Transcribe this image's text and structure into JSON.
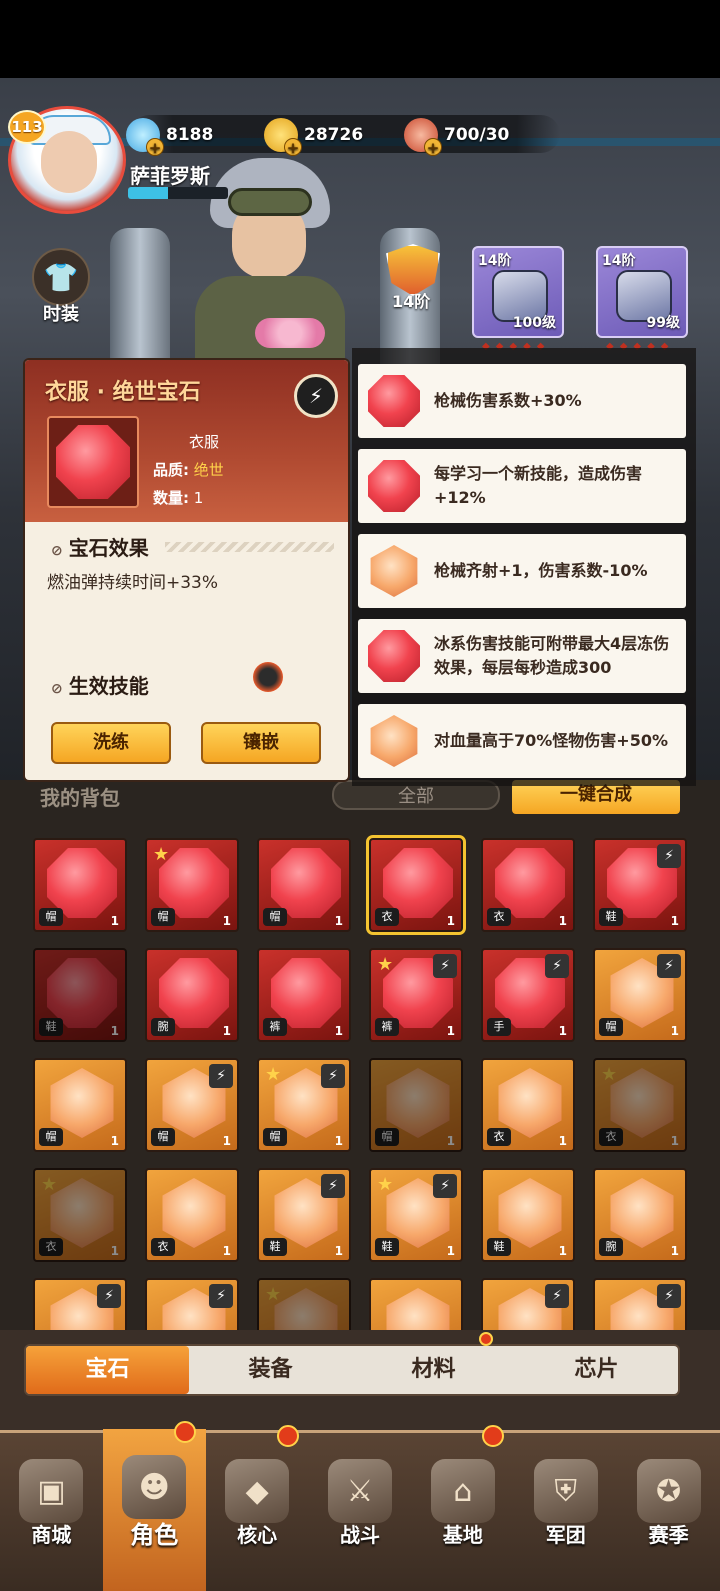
{
  "player": {
    "level": "113",
    "name": "萨菲罗斯"
  },
  "resources": {
    "gems": "8188",
    "coins": "28726",
    "stamina": "700/30"
  },
  "fashion_label": "时装",
  "rank_label": "14阶",
  "gear": [
    {
      "tier": "14阶",
      "level": "100级"
    },
    {
      "tier": "14阶",
      "level": "99级"
    }
  ],
  "detail": {
    "title": "衣服 · 绝世宝石",
    "type": "衣服",
    "quality_label": "品质:",
    "quality_value": "绝世",
    "count_label": "数量:",
    "count_value": "1",
    "effect_title": "宝石效果",
    "effect_text": "燃油弹持续时间+33%",
    "skill_title": "生效技能",
    "btn_reroll": "洗练",
    "btn_inlay": "镶嵌"
  },
  "effects": [
    {
      "gem": "red",
      "text": "枪械伤害系数+30%"
    },
    {
      "gem": "red",
      "text": "每学习一个新技能，造成伤害+12%"
    },
    {
      "gem": "orange",
      "text": "枪械齐射+1，伤害系数-10%"
    },
    {
      "gem": "red",
      "text": "冰系伤害技能可附带最大4层冻伤效果，每层每秒造成300"
    },
    {
      "gem": "orange",
      "text": "对血量高于70%怪物伤害+50%"
    }
  ],
  "bag": {
    "title": "我的背包",
    "filter": "全部",
    "combine": "一键合成"
  },
  "grid": [
    {
      "c": "red",
      "slot": "帽",
      "q": "1"
    },
    {
      "c": "red",
      "slot": "帽",
      "q": "1",
      "star": true
    },
    {
      "c": "red",
      "slot": "帽",
      "q": "1"
    },
    {
      "c": "red",
      "slot": "衣",
      "q": "1",
      "sel": true
    },
    {
      "c": "red",
      "slot": "衣",
      "q": "1"
    },
    {
      "c": "red",
      "slot": "鞋",
      "q": "1",
      "lock": true
    },
    {
      "c": "red",
      "slot": "鞋",
      "q": "1",
      "dim": true
    },
    {
      "c": "red",
      "slot": "腕",
      "q": "1"
    },
    {
      "c": "red",
      "slot": "裤",
      "q": "1"
    },
    {
      "c": "red",
      "slot": "裤",
      "q": "1",
      "star": true,
      "lock": true
    },
    {
      "c": "red",
      "slot": "手",
      "q": "1",
      "lock": true
    },
    {
      "c": "org",
      "slot": "帽",
      "q": "1",
      "lock": true
    },
    {
      "c": "org",
      "slot": "帽",
      "q": "1"
    },
    {
      "c": "org",
      "slot": "帽",
      "q": "1",
      "lock": true
    },
    {
      "c": "org",
      "slot": "帽",
      "q": "1",
      "star": true,
      "lock": true
    },
    {
      "c": "org",
      "slot": "帽",
      "q": "1",
      "dim": true
    },
    {
      "c": "org",
      "slot": "衣",
      "q": "1"
    },
    {
      "c": "org",
      "slot": "衣",
      "q": "1",
      "star": true,
      "dim": true
    },
    {
      "c": "org",
      "slot": "衣",
      "q": "1",
      "star": true,
      "dim": true
    },
    {
      "c": "org",
      "slot": "衣",
      "q": "1"
    },
    {
      "c": "org",
      "slot": "鞋",
      "q": "1",
      "lock": true
    },
    {
      "c": "org",
      "slot": "鞋",
      "q": "1",
      "star": true,
      "lock": true
    },
    {
      "c": "org",
      "slot": "鞋",
      "q": "1"
    },
    {
      "c": "org",
      "slot": "腕",
      "q": "1"
    },
    {
      "c": "org",
      "slot": "",
      "q": "",
      "lock": true
    },
    {
      "c": "org",
      "slot": "",
      "q": "",
      "lock": true
    },
    {
      "c": "org",
      "slot": "",
      "q": "",
      "star": true,
      "dim": true
    },
    {
      "c": "org",
      "slot": "",
      "q": ""
    },
    {
      "c": "org",
      "slot": "",
      "q": "",
      "lock": true
    },
    {
      "c": "org",
      "slot": "",
      "q": "",
      "lock": true
    }
  ],
  "tabs": [
    "宝石",
    "装备",
    "材料",
    "芯片"
  ],
  "nav": [
    {
      "label": "商城",
      "icon": "shop-icon"
    },
    {
      "label": "角色",
      "icon": "character-icon",
      "active": true
    },
    {
      "label": "核心",
      "icon": "core-icon"
    },
    {
      "label": "战斗",
      "icon": "battle-icon"
    },
    {
      "label": "基地",
      "icon": "base-icon"
    },
    {
      "label": "军团",
      "icon": "legion-icon"
    },
    {
      "label": "赛季",
      "icon": "season-icon"
    }
  ],
  "colors": {
    "accent": "#f5a623",
    "gem_red": "#f1434e",
    "gem_orange": "#f7a86b",
    "panel_header": "#8e2f22"
  }
}
